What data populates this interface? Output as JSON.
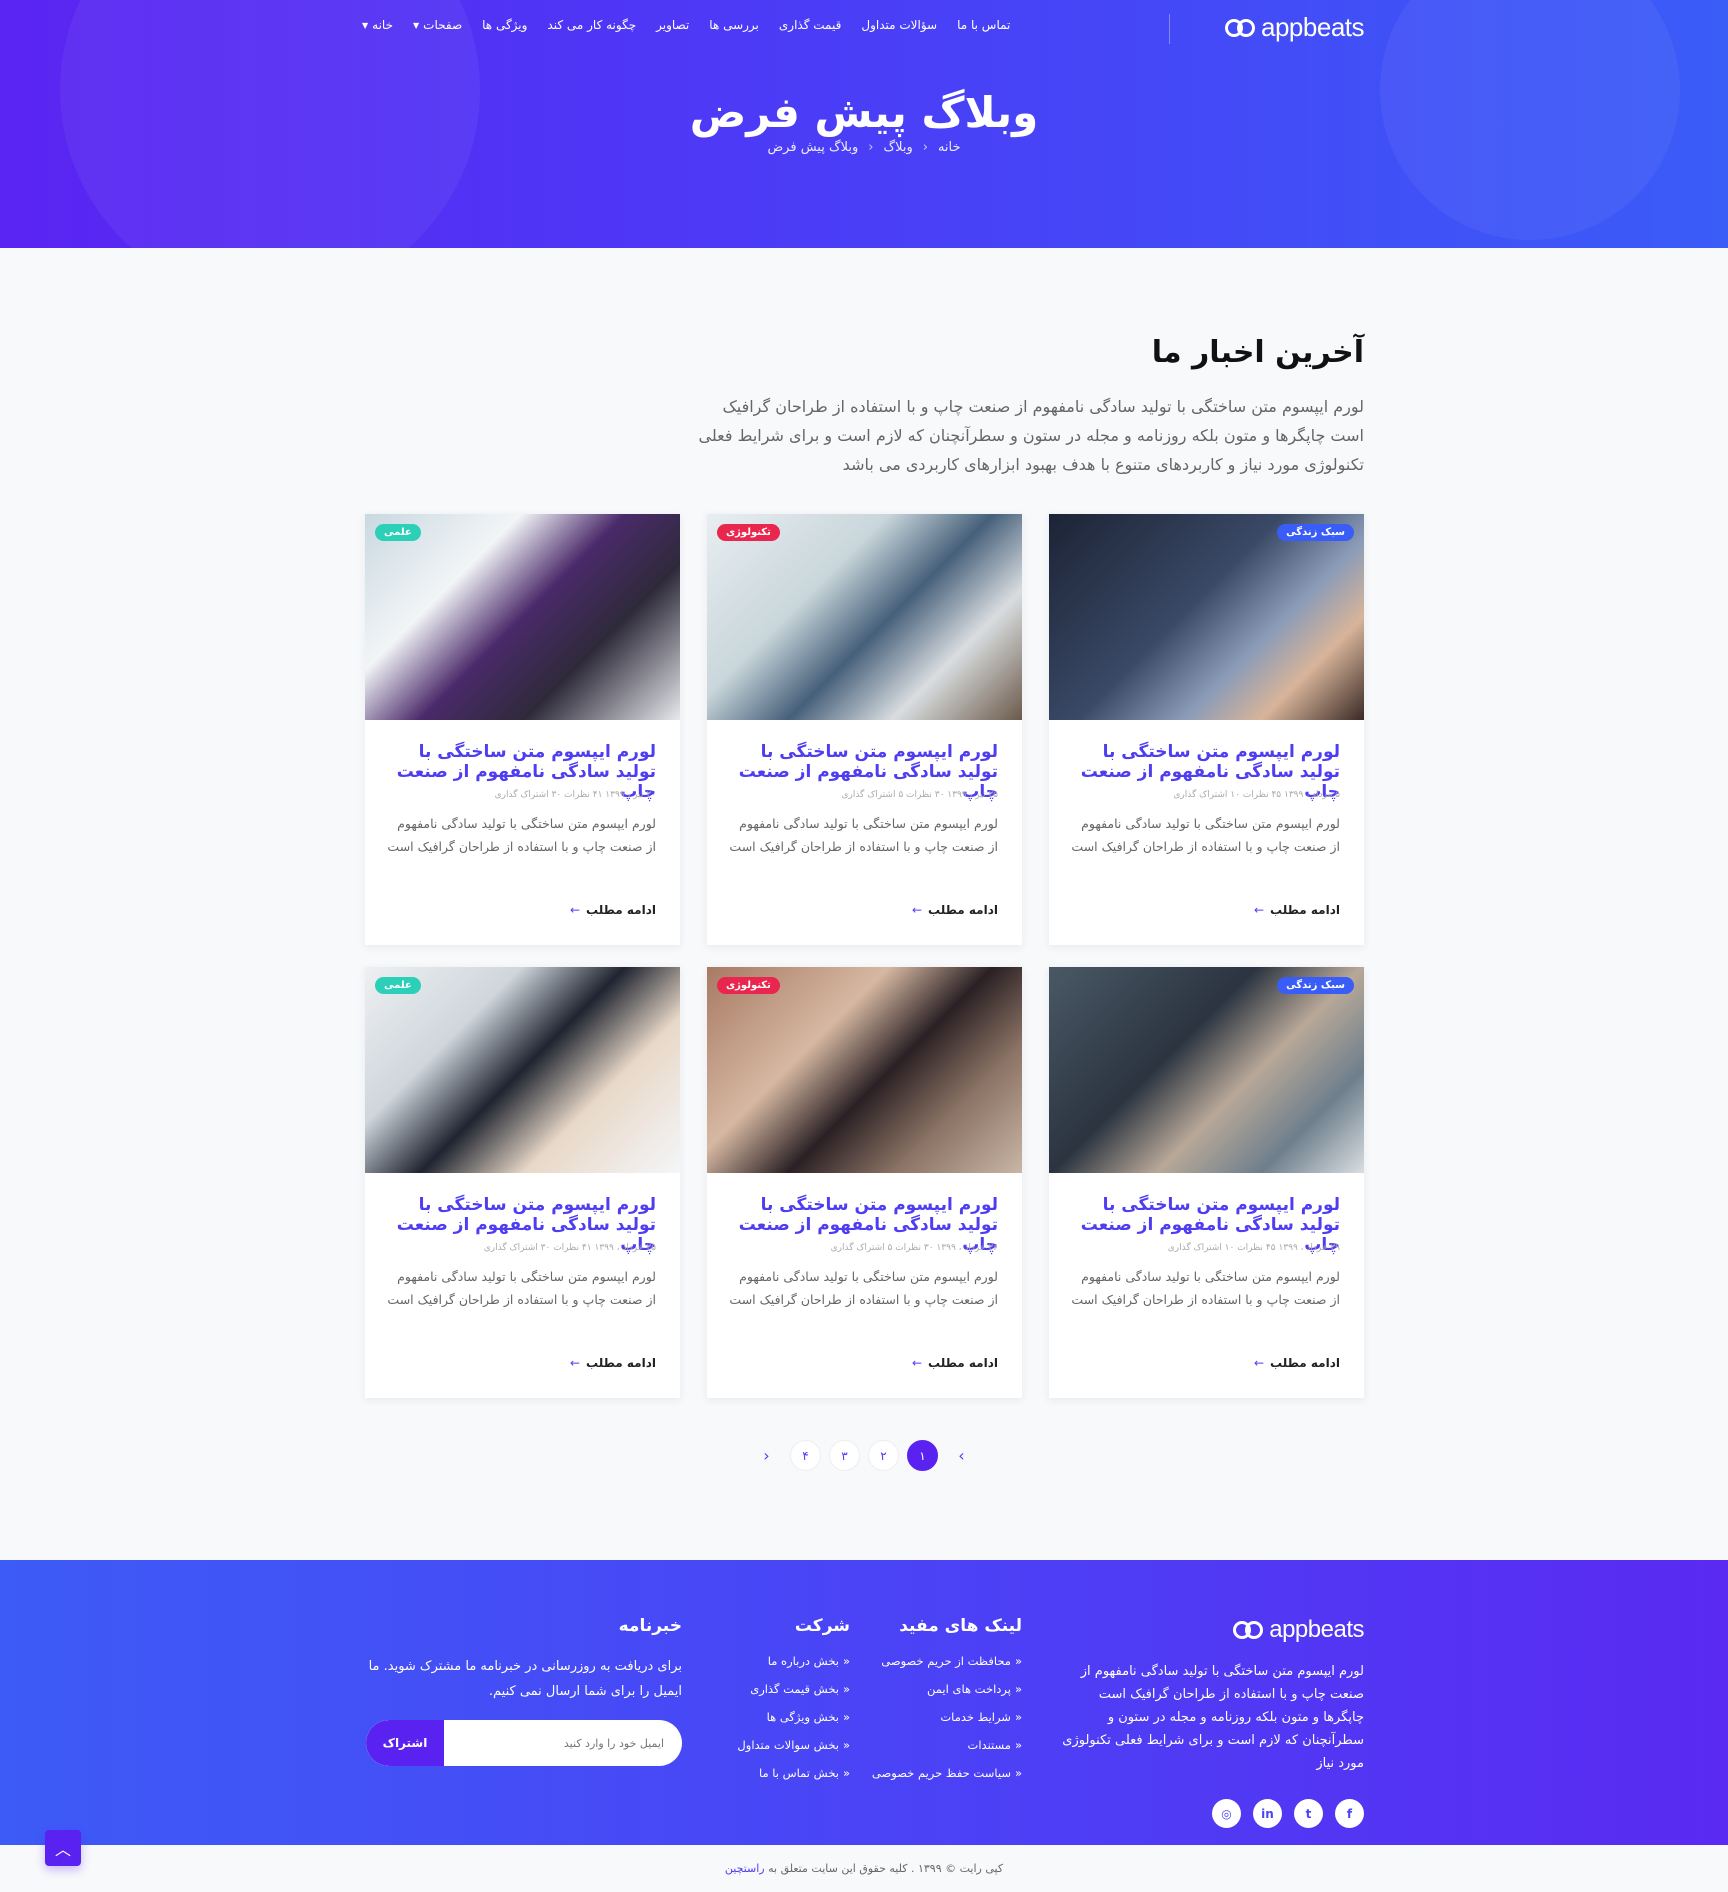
{
  "colors": {
    "primary": "#5a22f0",
    "accent": "#4f3df2",
    "badge_science": "#2ccfb8",
    "badge_tech": "#e8264e",
    "badge_life": "#3a5cf7"
  },
  "brand": {
    "name": "appbeats"
  },
  "nav": {
    "items": [
      "خانه",
      "صفحات",
      "ویژگی ها",
      "چگونه کار می کند",
      "تصاویر",
      "بررسی ها",
      "قیمت گذاری",
      "سؤالات متداول",
      "تماس با ما"
    ]
  },
  "hero": {
    "title": "وبلاگ پیش فرض",
    "breadcrumb": [
      "خانه",
      "وبلاگ",
      "وبلاگ پیش فرض"
    ]
  },
  "section": {
    "title": "آخرین اخبار ما",
    "description": "لورم ایپسوم متن ساختگی با تولید سادگی نامفهوم از صنعت چاپ و با استفاده از طراحان گرافیک است چاپگرها و متون بلکه روزنامه و مجله در ستون و سطرآنچنان که لازم است و برای شرایط فعلی تکنولوژی مورد نیاز و کاربردهای متنوع با هدف بهبود ابزارهای کاربردی می باشد"
  },
  "cards": [
    {
      "badge": "سبک زندگی",
      "title": "لورم ایپسوم متن ساختگی با تولید سادگی نامفهوم از صنعت چاپ",
      "meta": "۵ مرداد ، ۱۳۹۹   ۴۵ نظرات   ۱۰ اشتراک گذاری",
      "excerpt": "لورم ایپسوم متن ساختگی با تولید سادگی نامفهوم از صنعت چاپ و با استفاده از طراحان گرافیک است",
      "more": "ادامه مطلب"
    },
    {
      "badge": "تکنولوژی",
      "title": "لورم ایپسوم متن ساختگی با تولید سادگی نامفهوم از صنعت چاپ",
      "meta": "۲۵ تیر ، ۱۳۹۹   ۳۰ نظرات   ۵ اشتراک گذاری",
      "excerpt": "لورم ایپسوم متن ساختگی با تولید سادگی نامفهوم از صنعت چاپ و با استفاده از طراحان گرافیک است",
      "more": "ادامه مطلب"
    },
    {
      "badge": "علمی",
      "title": "لورم ایپسوم متن ساختگی با تولید سادگی نامفهوم از صنعت چاپ",
      "meta": "۲۰ تیر ، ۱۳۹۹   ۴۱ نظرات   ۳۰ اشتراک گذاری",
      "excerpt": "لورم ایپسوم متن ساختگی با تولید سادگی نامفهوم از صنعت چاپ و با استفاده از طراحان گرافیک است",
      "more": "ادامه مطلب"
    },
    {
      "badge": "سبک زندگی",
      "title": "لورم ایپسوم متن ساختگی با تولید سادگی نامفهوم از صنعت چاپ",
      "meta": "۲۹ خرداد ، ۱۳۹۹   ۴۵ نظرات   ۱۰ اشتراک گذاری",
      "excerpt": "لورم ایپسوم متن ساختگی با تولید سادگی نامفهوم از صنعت چاپ و با استفاده از طراحان گرافیک است",
      "more": "ادامه مطلب"
    },
    {
      "badge": "تکنولوژی",
      "title": "لورم ایپسوم متن ساختگی با تولید سادگی نامفهوم از صنعت چاپ",
      "meta": "۲۶ خرداد ، ۱۳۹۹   ۳۰ نظرات   ۵ اشتراک گذاری",
      "excerpt": "لورم ایپسوم متن ساختگی با تولید سادگی نامفهوم از صنعت چاپ و با استفاده از طراحان گرافیک است",
      "more": "ادامه مطلب"
    },
    {
      "badge": "علمی",
      "title": "لورم ایپسوم متن ساختگی با تولید سادگی نامفهوم از صنعت چاپ",
      "meta": "۲۵ خرداد ، ۱۳۹۹   ۴۱ نظرات   ۳۰ اشتراک گذاری",
      "excerpt": "لورم ایپسوم متن ساختگی با تولید سادگی نامفهوم از صنعت چاپ و با استفاده از طراحان گرافیک است",
      "more": "ادامه مطلب"
    }
  ],
  "pagination": {
    "pages": [
      "۱",
      "۲",
      "۳",
      "۴"
    ],
    "active": "۱",
    "prev": "‹",
    "next": "›"
  },
  "footer": {
    "about": "لورم ایپسوم متن ساختگی با تولید سادگی نامفهوم از صنعت چاپ و با استفاده از طراحان گرافیک است چاپگرها و متون بلکه روزنامه و مجله در ستون و سطرآنچنان که لازم است و برای شرایط فعلی تکنولوژی مورد نیاز",
    "social": [
      "f",
      "t",
      "in",
      "◎"
    ],
    "links_title": "لینک های مفید",
    "links": [
      "محافظت از حریم خصوصی",
      "پرداخت های ایمن",
      "شرایط خدمات",
      "مستندات",
      "سیاست حفظ حریم خصوصی"
    ],
    "company_title": "شرکت",
    "company": [
      "بخش درباره ما",
      "بخش قیمت گذاری",
      "بخش ویژگی ها",
      "بخش سوالات متداول",
      "بخش تماس با ما"
    ],
    "newsletter_title": "خبرنامه",
    "newsletter_text": "برای دریافت به روزرسانی در خبرنامه ما مشترک شوید. ما ایمیل را برای شما ارسال نمی کنیم.",
    "email_placeholder": "ایمیل خود را وارد کنید",
    "subscribe_label": "اشتراک"
  },
  "copyright": {
    "text": "کپی رایت © ۱۳۹۹ . کلیه حقوق این سایت متعلق به",
    "brand": "راستچین"
  },
  "to_top": "︿"
}
